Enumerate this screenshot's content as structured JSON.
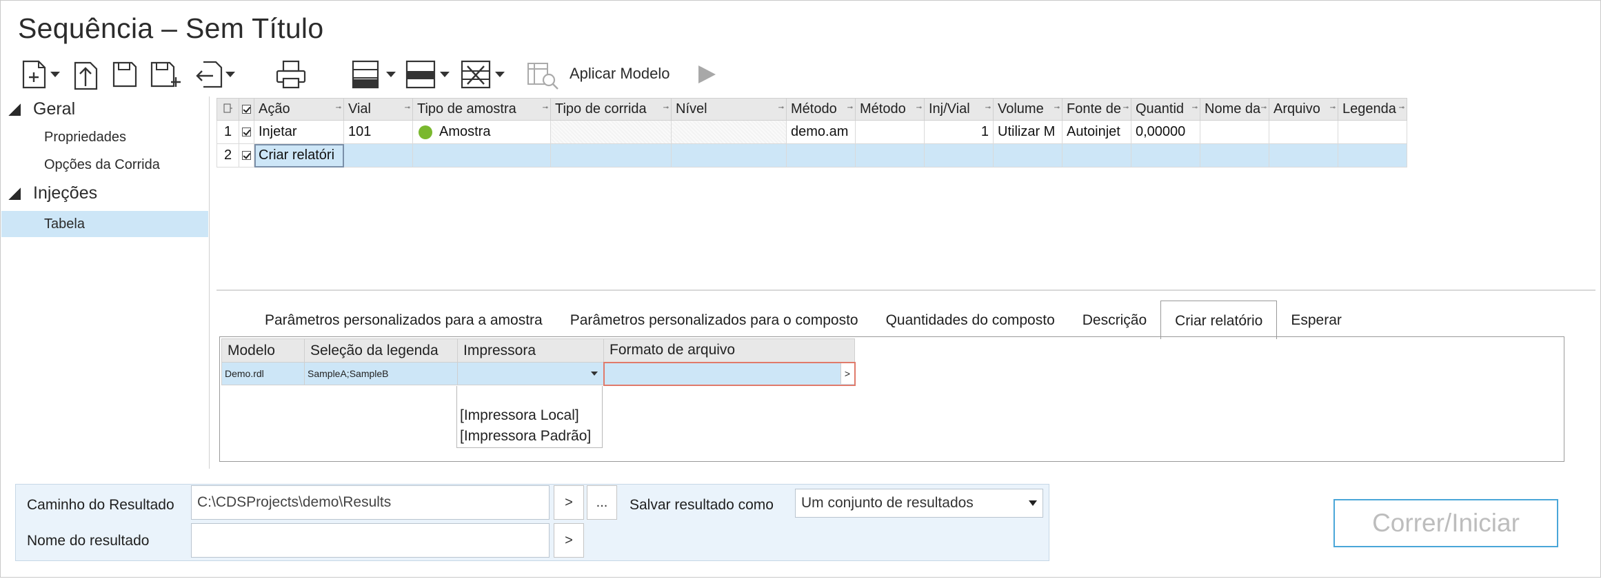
{
  "window": {
    "title": "Sequência – Sem Título"
  },
  "toolbar": {
    "icons": [
      "new-icon",
      "open-icon",
      "save-icon",
      "save-as-icon",
      "import-icon",
      "print-icon",
      "insert-row-icon",
      "insert-below-icon",
      "delete-row-icon",
      "apply-model-icon",
      "run-icon"
    ],
    "apply_model_label": "Aplicar Modelo"
  },
  "nav": {
    "groups": [
      {
        "label": "Geral",
        "items": [
          "Propriedades",
          "Opções da Corrida"
        ]
      },
      {
        "label": "Injeções",
        "items": [
          "Tabela"
        ]
      }
    ],
    "selected": "Tabela"
  },
  "grid": {
    "columns": [
      "Ação",
      "Vial",
      "Tipo de amostra",
      "Tipo de corrida",
      "Nível",
      "Método",
      "Método",
      "Inj/Vial",
      "Volume",
      "Fonte de",
      "Quantid",
      "Nome da",
      "Arquivo",
      "Legenda"
    ],
    "rows": [
      {
        "index": "1",
        "checked": true,
        "acao": "Injetar",
        "vial": "101",
        "tipo_amostra": "Amostra",
        "tipo_amostra_color": "#7ab82e",
        "metodo1": "demo.am",
        "inj_vial": "1",
        "volume": "Utilizar M",
        "fonte": "Autoinjet",
        "quantid": "0,00000"
      },
      {
        "index": "2",
        "checked": true,
        "acao": "Criar relatóri"
      }
    ]
  },
  "tabs": {
    "items": [
      "Parâmetros personalizados para a amostra",
      "Parâmetros personalizados para o composto",
      "Quantidades do composto",
      "Descrição",
      "Criar relatório",
      "Esperar"
    ],
    "active": "Criar relatório"
  },
  "report": {
    "columns": [
      "Modelo",
      "Seleção da legenda",
      "Impressora",
      "Formato de arquivo"
    ],
    "row": {
      "modelo": "Demo.rdl",
      "legenda": "SampleA;SampleB",
      "impressora": "",
      "formato": ""
    },
    "format_button": ">",
    "printer_options": [
      "[Impressora Local]",
      "[Impressora Padrão]"
    ]
  },
  "result": {
    "path_label": "Caminho do Resultado",
    "path_value": "C:\\CDSProjects\\demo\\Results",
    "path_btn": ">",
    "browse_btn": "...",
    "save_as_label": "Salvar resultado como",
    "save_as_value": "Um conjunto de resultados",
    "name_label": "Nome do resultado",
    "name_value": "",
    "name_btn": ">"
  },
  "run_button": "Correr/Iniciar",
  "colors": {
    "selection": "#cde6f7",
    "run_border": "#49a6d8",
    "accent_green": "#7ab82e"
  }
}
